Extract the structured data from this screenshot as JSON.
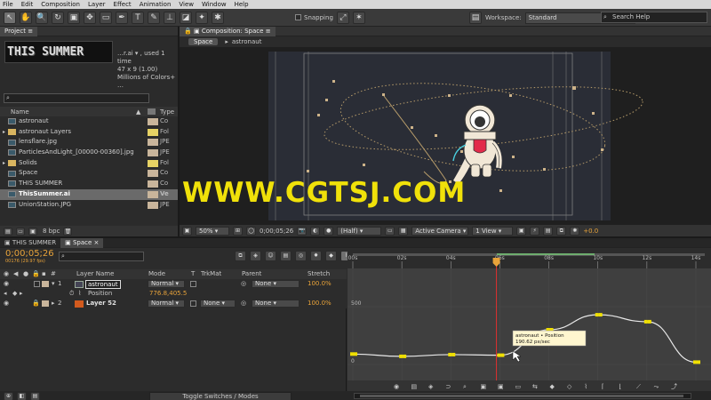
{
  "menu": [
    "File",
    "Edit",
    "Composition",
    "Layer",
    "Effect",
    "Animation",
    "View",
    "Window",
    "Help"
  ],
  "toolbar": {
    "snapping_label": "Snapping",
    "workspace_label": "Workspace:",
    "workspace_value": "Standard",
    "search_placeholder": "Search Help"
  },
  "project": {
    "tab_label": "Project",
    "preview_name": "…r.ai ▾ , used 1 time",
    "preview_dims": "47 x 9 (1.00)",
    "preview_colors": "Millions of Colors+ …",
    "preview_text": "THIS SUMMER",
    "col_name": "Name",
    "col_type": "Type",
    "items": [
      {
        "name": "astronaut",
        "type": "Co",
        "label_color": "#c9b59b"
      },
      {
        "name": "astronaut Layers",
        "type": "Fol",
        "label_color": "#e6d264"
      },
      {
        "name": "lensflare.jpg",
        "type": "JPE",
        "label_color": "#c9b59b"
      },
      {
        "name": "ParticlesAndLight_[00000-00360].jpg",
        "type": "JPE",
        "label_color": "#c9b59b"
      },
      {
        "name": "Solids",
        "type": "Fol",
        "label_color": "#e6d264"
      },
      {
        "name": "Space",
        "type": "Co",
        "label_color": "#c9b59b"
      },
      {
        "name": "THIS SUMMER",
        "type": "Co",
        "label_color": "#c9b59b"
      },
      {
        "name": "ThisSummer.ai",
        "type": "Ve",
        "label_color": "#c9b59b"
      },
      {
        "name": "UnionStation.JPG",
        "type": "JPE",
        "label_color": "#c9b59b"
      }
    ],
    "bpc": "8 bpc"
  },
  "composition": {
    "tab_label": "Composition: Space",
    "crumb_active": "Space",
    "crumb_child": "astronaut",
    "zoom": "50%",
    "timecode": "0;00;05;26",
    "resolution": "(Half)",
    "camera": "Active Camera",
    "view": "1 View",
    "exposure": "+0.0"
  },
  "timeline": {
    "tabs": [
      "THIS SUMMER",
      "Space"
    ],
    "timecode": "0;00;05;26",
    "fps": "00176 (29.97 fps)",
    "col_layer_name": "Layer Name",
    "col_mode": "Mode",
    "col_t": "T",
    "col_trkmat": "TrkMat",
    "col_parent": "Parent",
    "col_stretch": "Stretch",
    "layers": [
      {
        "num": "1",
        "name": "astronaut",
        "mode": "Normal",
        "parent": "None",
        "stretch": "100.0%"
      },
      {
        "num": "2",
        "name": "Layer 52",
        "mode": "Normal",
        "trkmat": "None",
        "parent": "None",
        "stretch": "100.0%"
      }
    ],
    "position_label": "Position",
    "position_value": "776.8,405.5",
    "ruler_ticks": [
      "00s",
      "02s",
      "04s",
      "06s",
      "08s",
      "10s",
      "12s",
      "14s"
    ],
    "graph_y_labels": [
      "500",
      "0"
    ],
    "tooltip_title": "astronaut • Position",
    "tooltip_value": "190.62 px/sec",
    "toggle_label": "Toggle Switches / Modes"
  },
  "watermark": "WWW.CGTSJ.COM",
  "chart_data": {
    "type": "line",
    "title": "",
    "xlabel": "",
    "ylabel": "",
    "x": [
      0,
      2,
      4,
      6,
      8,
      10,
      12,
      14
    ],
    "y_ticks": [
      500,
      0
    ],
    "series": [
      {
        "values": [
          90,
          70,
          85,
          80,
          300,
          430,
          370,
          20
        ]
      }
    ]
  }
}
